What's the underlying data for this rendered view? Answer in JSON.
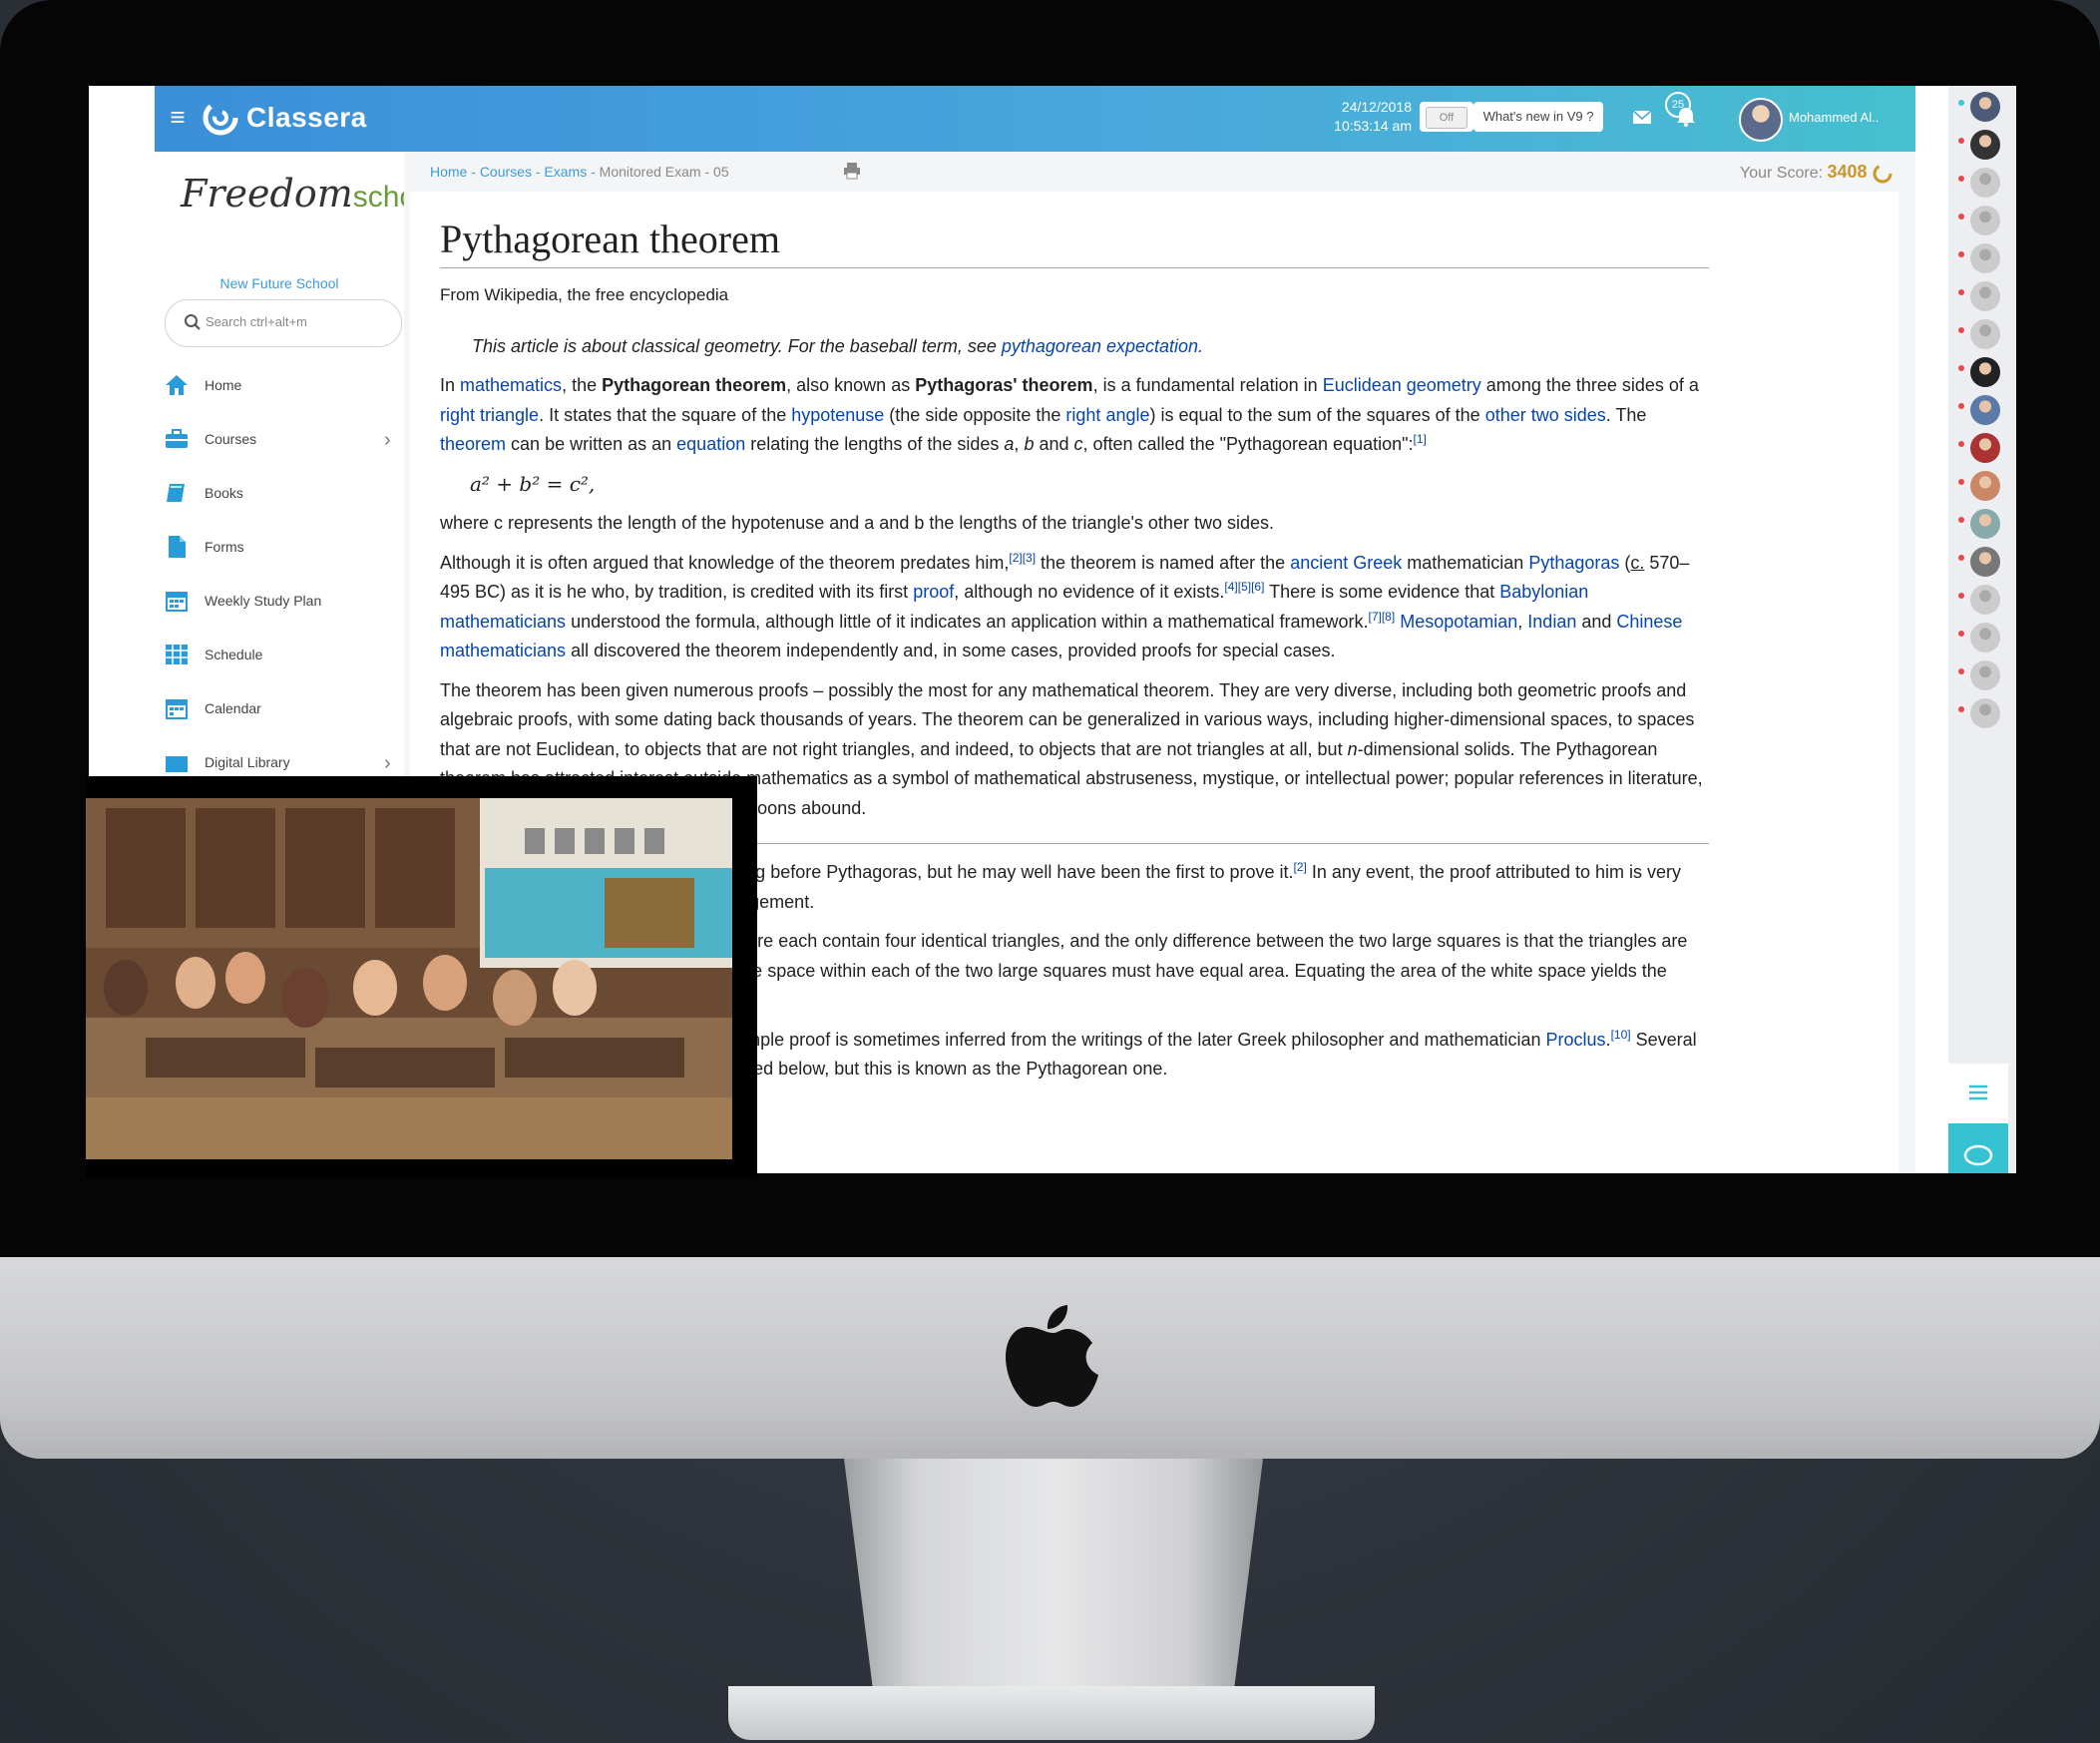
{
  "app": {
    "name": "Classera",
    "datetime": {
      "date": "24/12/2018",
      "time": "10:53:14 am"
    },
    "toggle_label": "Off",
    "whats_new": "What's new in V9 ?",
    "notification_count": "25",
    "user_name": "Mohammed Al..",
    "brand_color": "#3a8fd8"
  },
  "sidebar": {
    "school_logo_a": "Freedom",
    "school_logo_b": "school",
    "school_name": "New Future School",
    "search_placeholder": "Search ctrl+alt+m",
    "items": [
      {
        "label": "Home",
        "icon": "home-icon"
      },
      {
        "label": "Courses",
        "icon": "briefcase-icon"
      },
      {
        "label": "Books",
        "icon": "book-icon"
      },
      {
        "label": "Forms",
        "icon": "form-icon"
      },
      {
        "label": "Weekly Study Plan",
        "icon": "calendar-icon"
      },
      {
        "label": "Schedule",
        "icon": "grid-icon"
      },
      {
        "label": "Calendar",
        "icon": "calendar-icon"
      },
      {
        "label": "Digital Library",
        "icon": "library-icon"
      }
    ]
  },
  "breadcrumb": {
    "home": "Home",
    "courses": "Courses",
    "exams": "Exams",
    "current": "Monitored Exam - 05",
    "sep": " - "
  },
  "score": {
    "label": "Your Score:",
    "value": "3408"
  },
  "article": {
    "title": "Pythagorean theorem",
    "source": "From Wikipedia, the free encyclopedia",
    "hatnote_text": "This article is about classical geometry. For the baseball term, see ",
    "hatnote_link": "pythagorean expectation.",
    "formula": "a² + b² = c²,",
    "p2": "where c represents the length of the hypotenuse and a and b the lengths of the triangle's other two sides."
  },
  "video": {
    "description": "classroom video feed"
  },
  "colors": {
    "link": "#0645ad",
    "score": "#c9972a",
    "chat": "#35c2d3"
  }
}
